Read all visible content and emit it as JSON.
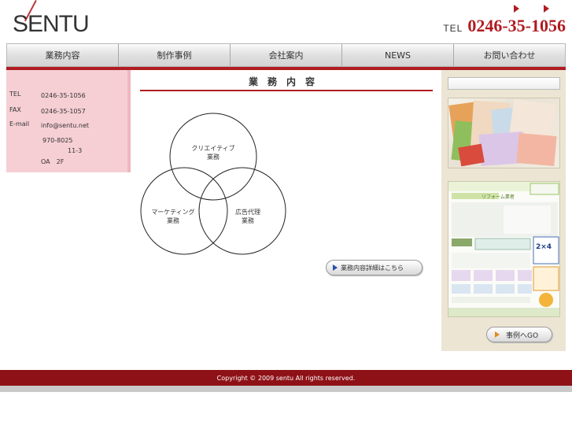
{
  "header": {
    "logo": "SENTU",
    "tel_label": "TEL",
    "tel_number": "0246-35-1056"
  },
  "nav": {
    "items": [
      {
        "label": "業務内容"
      },
      {
        "label": "制作事例"
      },
      {
        "label": "会社案内"
      },
      {
        "label": "NEWS"
      },
      {
        "label": "お問い合わせ"
      }
    ]
  },
  "contact": {
    "tel_key": "TEL",
    "tel_value": "0246-35-1056",
    "fax_key": "FAX",
    "fax_value": "0246-35-1057",
    "email_key": "E-mail",
    "email_value": "info@sentu.net",
    "zip": "970-8025",
    "address_num": "11-3",
    "building": "OA　2F"
  },
  "main": {
    "title": "業務内容",
    "venn": {
      "top": [
        "クリエイティブ",
        "業務"
      ],
      "left": [
        "マーケティング",
        "業務"
      ],
      "right": [
        "広告代理",
        "業務"
      ]
    },
    "detail_button": "業務内容詳細はこちら"
  },
  "sidebar": {
    "go_button": "事例へGO",
    "thumb2_banner": "リフォーム業者",
    "thumb2_badge": "2×4"
  },
  "footer": {
    "copyright": "Copyright © 2009 sentu All rights reserved."
  },
  "colors": {
    "accent": "#b01c22",
    "footer_bg": "#8e1117",
    "contact_bg": "#f6cfd5",
    "sidebar_bg": "#ece5d4"
  }
}
